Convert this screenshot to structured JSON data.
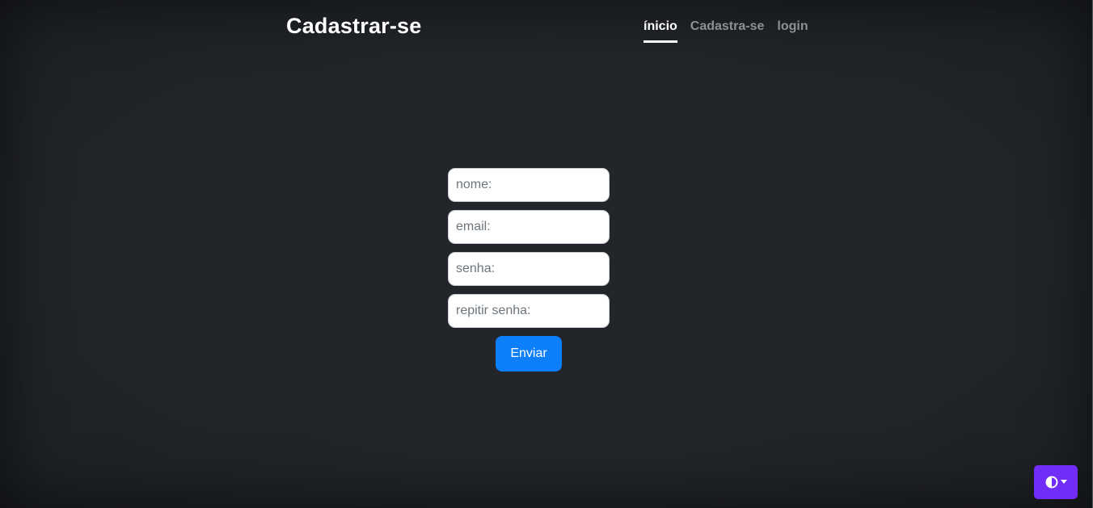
{
  "header": {
    "brand": "Cadastrar-se",
    "nav": [
      {
        "label": "ínicio",
        "active": true
      },
      {
        "label": "Cadastra-se",
        "active": false
      },
      {
        "label": "login",
        "active": false
      }
    ]
  },
  "form": {
    "name_placeholder": "nome:",
    "email_placeholder": "email:",
    "password_placeholder": "senha:",
    "repeat_password_placeholder": "repitir senha:",
    "submit_label": "Enviar"
  },
  "theme_toggle": {
    "icon": "circle-half-icon",
    "caret_icon": "caret-down-icon",
    "color": "#712cf9"
  },
  "colors": {
    "background": "#212529",
    "primary": "#0d7ffb",
    "accent": "#712cf9"
  }
}
